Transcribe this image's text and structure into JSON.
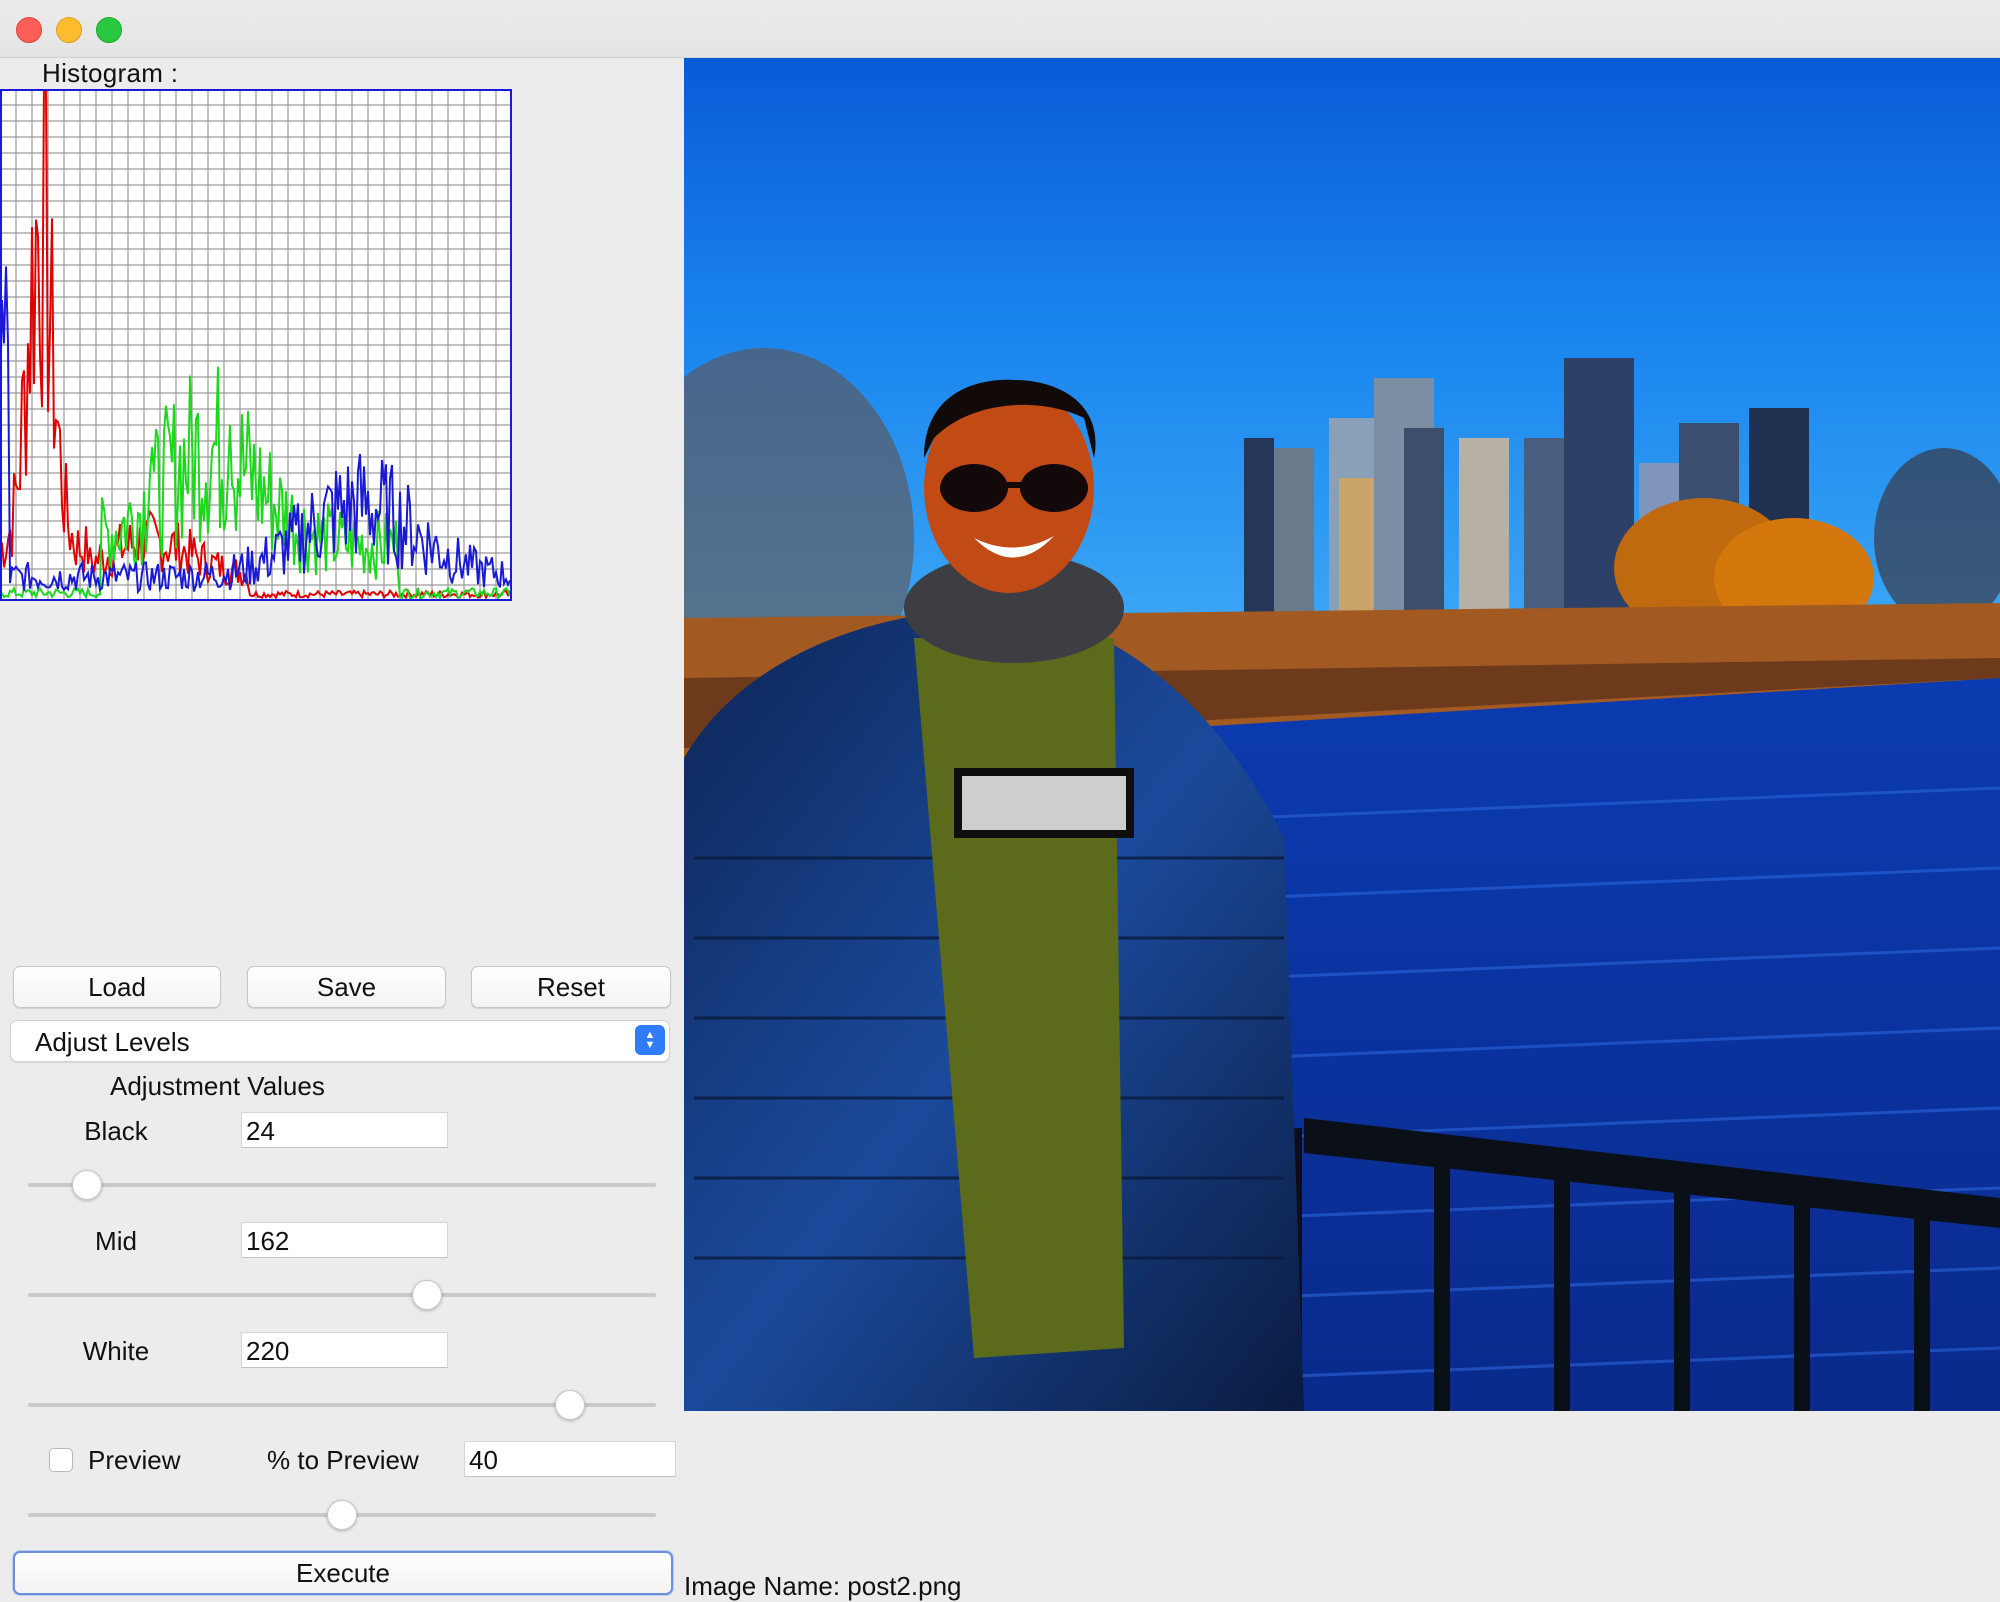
{
  "histogram": {
    "label": "Histogram :",
    "colors": {
      "red": "#e00000",
      "green": "#1bd81b",
      "blue": "#1a1ad6",
      "grid": "#9a9a9a"
    }
  },
  "toolbar": {
    "load_label": "Load",
    "save_label": "Save",
    "reset_label": "Reset"
  },
  "operation_select": {
    "selected": "Adjust Levels"
  },
  "adjustments": {
    "title": "Adjustment Values",
    "black": {
      "label": "Black",
      "value": "24",
      "slider": 24
    },
    "mid": {
      "label": "Mid",
      "value": "162",
      "slider": 162
    },
    "white": {
      "label": "White",
      "value": "220",
      "slider": 220
    },
    "slider_max": 255
  },
  "preview": {
    "checkbox_label": "Preview",
    "checked": false,
    "percent_label": "% to Preview",
    "percent_value": "40",
    "slider": 50
  },
  "execute_label": "Execute",
  "image_name": "Image Name: post2.png",
  "accent_color": "#2f7cf6"
}
